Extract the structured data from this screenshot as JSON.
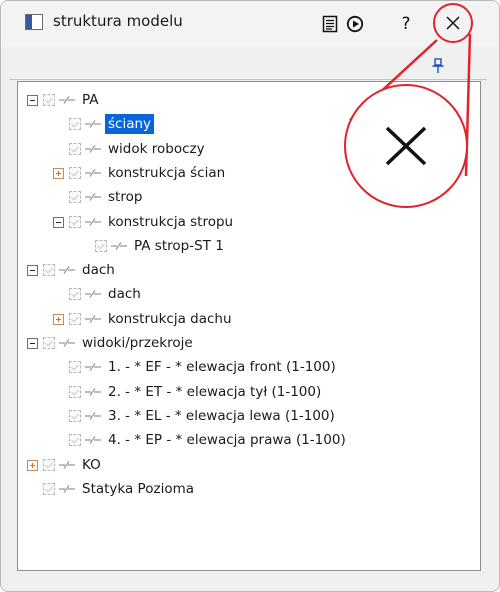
{
  "window": {
    "title": "struktura modelu",
    "close_glyph": "✕",
    "help_glyph": "?",
    "colors": {
      "annotation_red": "#e0242d",
      "selection_blue": "#0a66d8",
      "plus_orange": "#e07020"
    }
  },
  "toolbar": {
    "document_icon": "document-lines-icon",
    "play_icon": "play-circle-icon",
    "pin_icon": "pin-icon"
  },
  "tree": {
    "items": [
      {
        "label": "PA",
        "expander": "minus"
      },
      {
        "label": "ściany",
        "selected": true
      },
      {
        "label": "widok roboczy"
      },
      {
        "label": "konstrukcja ścian",
        "expander": "plus"
      },
      {
        "label": "strop"
      },
      {
        "label": "konstrukcja stropu",
        "expander": "minus"
      },
      {
        "label": "PA strop-ST 1"
      },
      {
        "label": "dach",
        "expander": "minus"
      },
      {
        "label": "dach"
      },
      {
        "label": "konstrukcja dachu",
        "expander": "plus"
      },
      {
        "label": "widoki/przekroje",
        "expander": "minus"
      },
      {
        "label": "1. - * EF - * elewacja front (1-100)"
      },
      {
        "label": "2. - * ET - * elewacja tył (1-100)"
      },
      {
        "label": "3. - * EL - * elewacja lewa (1-100)"
      },
      {
        "label": "4. - * EP - * elewacja prawa (1-100)"
      },
      {
        "label": "KO",
        "expander": "plus"
      },
      {
        "label": "Statyka Pozioma"
      }
    ]
  },
  "annotation": {
    "zoom_icon": "close-icon-magnified"
  }
}
